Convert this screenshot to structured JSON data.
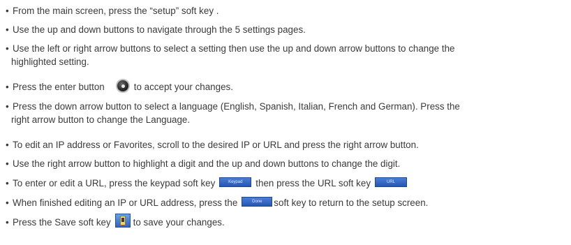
{
  "bullet_glyph": "•",
  "items": [
    {
      "text": "From the main screen, press the “setup” soft key ."
    },
    {
      "text": "Use the up and down buttons to navigate through the 5 settings pages."
    },
    {
      "line1": "Use the left or right arrow buttons to select a setting then use the up and down arrow buttons to change the",
      "line2": "highlighted setting."
    },
    {
      "before": "Press the enter button",
      "after": "to accept your changes.",
      "icon": "enter-button-icon"
    },
    {
      "line1": "Press the down arrow button to select a language (English, Spanish, Italian, French and German). Press the",
      "line2": "right arrow button to change the Language."
    },
    {
      "text": "To edit an IP address or Favorites, scroll to the desired IP or URL and press the right arrow button."
    },
    {
      "text": "Use the right arrow button to highlight a digit and the up and down buttons to change the digit."
    },
    {
      "before": "To enter or edit a URL, press the keypad soft key",
      "middle": "then press the URL soft key",
      "keypad_label": "Keypad",
      "url_label": "URL"
    },
    {
      "before": "When finished editing an IP or URL address, press the",
      "after": "soft key to return to the setup screen.",
      "done_label": "Done"
    },
    {
      "before": "Press the Save soft key",
      "after": "to save your changes.",
      "icon": "save-icon"
    }
  ]
}
